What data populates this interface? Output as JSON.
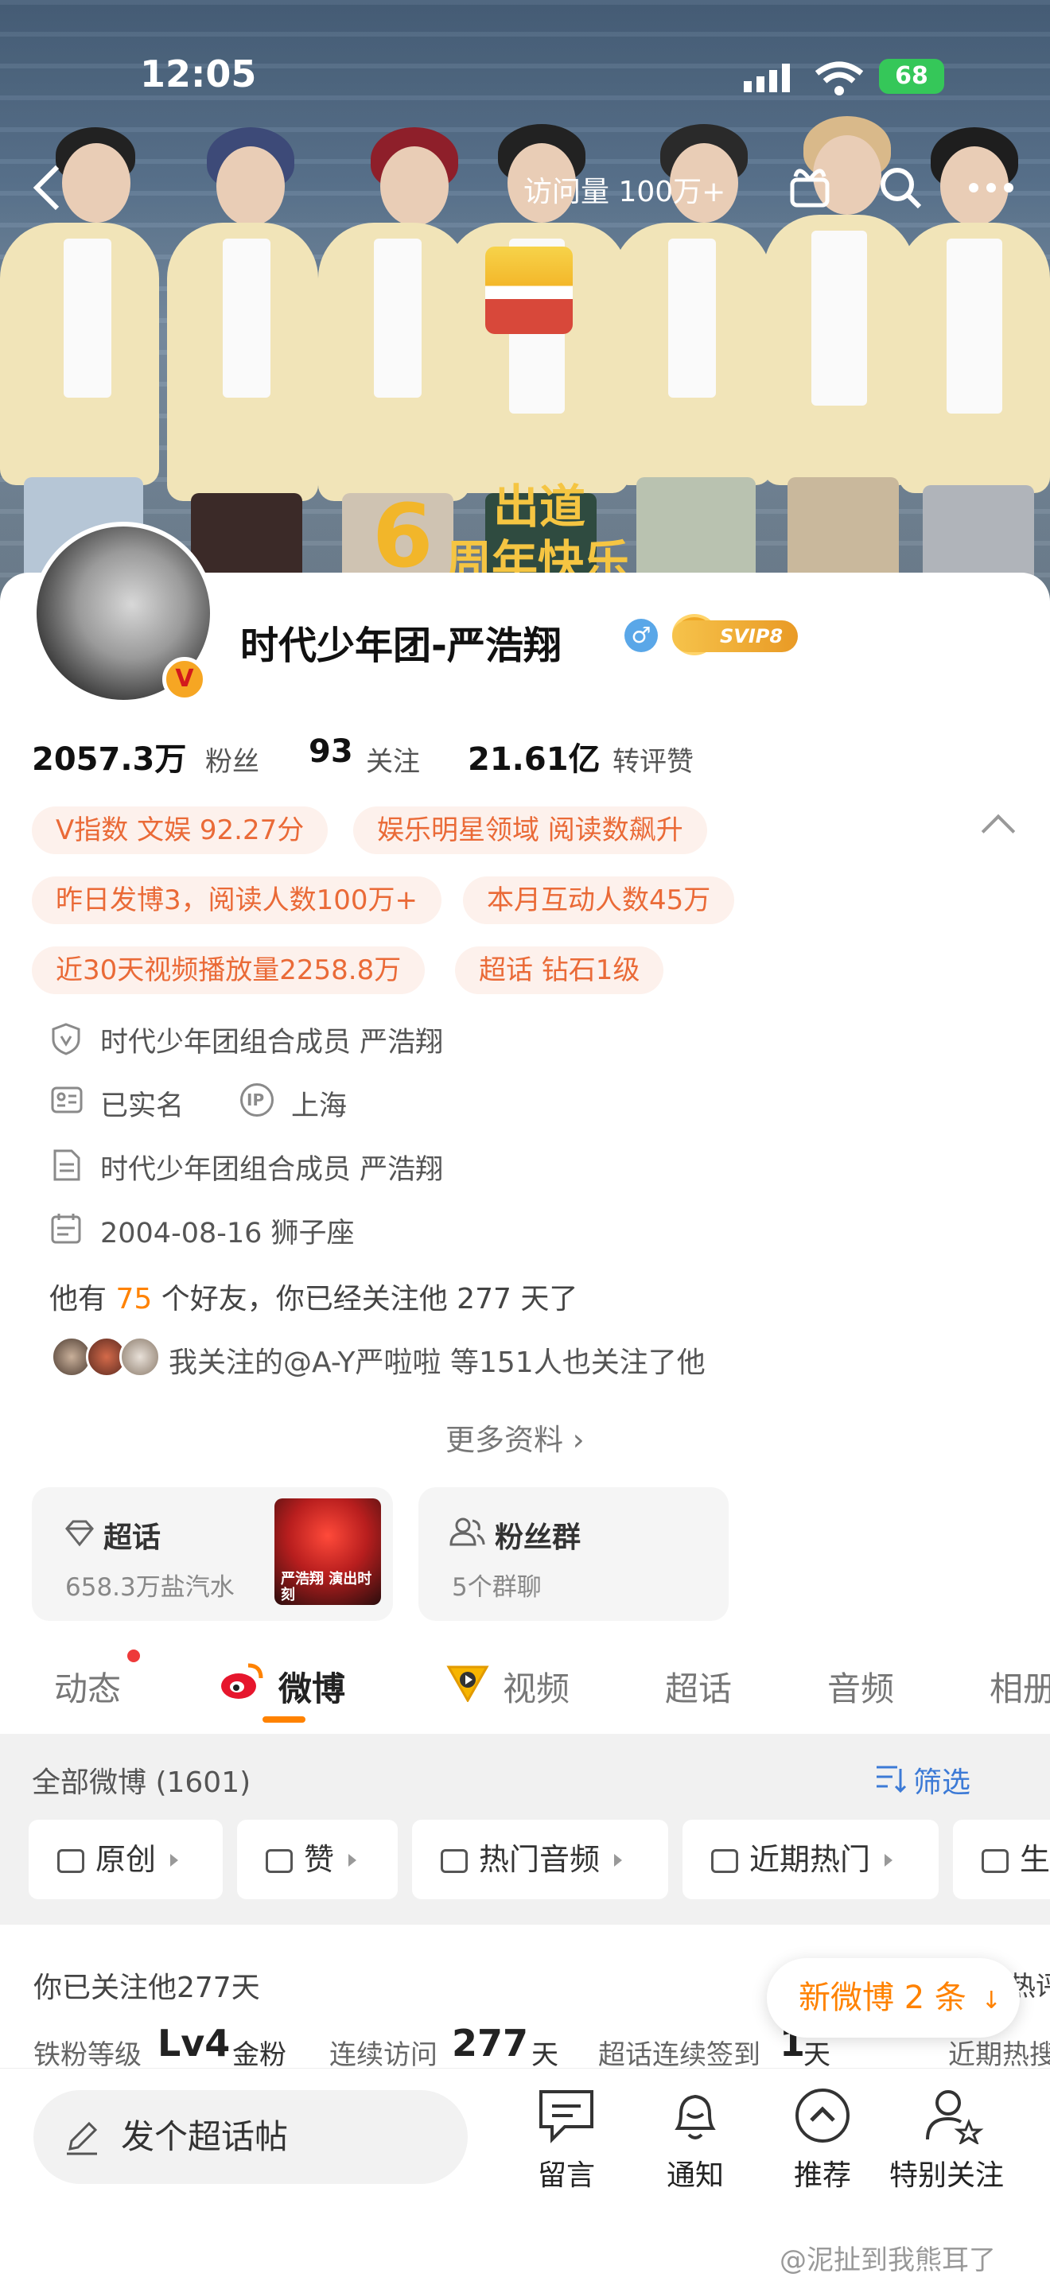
{
  "status_bar": {
    "time": "12:05",
    "battery": "68"
  },
  "nav": {
    "visits": "访问量 100万+"
  },
  "cover": {
    "banner_line1": "出道",
    "banner_num": "6",
    "banner_line2": "周年快乐"
  },
  "profile": {
    "name": "时代少年团-严浩翔",
    "badge_v": "V",
    "svip": "SVIP8",
    "gender_symbol": "♂"
  },
  "stats": [
    {
      "value": "2057.3万",
      "label": "粉丝"
    },
    {
      "value": "93",
      "label": "关注"
    },
    {
      "value": "21.61亿",
      "label": "转评赞"
    }
  ],
  "tags": [
    "V指数 文娱 92.27分",
    "娱乐明星领域 阅读数飙升",
    "昨日发博3，阅读人数100万+",
    "本月互动人数45万",
    "近30天视频播放量2258.8万",
    "超话 钻石1级"
  ],
  "info": {
    "verified": "时代少年团组合成员 严浩翔",
    "realname": "已实名",
    "ip_label": "IP",
    "location": "上海",
    "bio": "时代少年团组合成员 严浩翔",
    "birthday": "2004-08-16 狮子座"
  },
  "friends": {
    "prefix": "他有",
    "count": "75",
    "suffix": "个好友，你已经关注他 277 天了",
    "mutual": "我关注的@A-Y严啦啦 等151人也关注了他"
  },
  "more_info": "更多资料 ›",
  "boxes": {
    "supertopic": {
      "title": "超话",
      "sub": "658.3万盐汽水",
      "img_text": "严浩翔 演出时刻"
    },
    "fans_group": {
      "title": "粉丝群",
      "sub": "5个群聊"
    }
  },
  "tabs": [
    "动态",
    "微博",
    "视频",
    "超话",
    "音频",
    "相册"
  ],
  "filter": {
    "all": "全部微博 (1601)",
    "filter_btn": "筛选",
    "chips": [
      "原创",
      "赞",
      "热门音频",
      "近期热门",
      "生"
    ]
  },
  "follow": {
    "followed_days": "你已关注他277天",
    "hot_label": "热评",
    "level_label": "铁粉等级",
    "level_value": "Lv4",
    "level_suffix": "金粉",
    "visit_label": "连续访问",
    "visit_value": "277",
    "visit_unit": "天",
    "checkin_label": "超话连续签到",
    "checkin_value": "1",
    "checkin_unit": "天",
    "recent_label": "近期热搜"
  },
  "new_pill": "新微博 2 条",
  "bottom": {
    "post": "发个超话帖",
    "actions": [
      "留言",
      "通知",
      "推荐",
      "特别关注"
    ]
  },
  "watermark": "@泥扯到我熊耳了"
}
